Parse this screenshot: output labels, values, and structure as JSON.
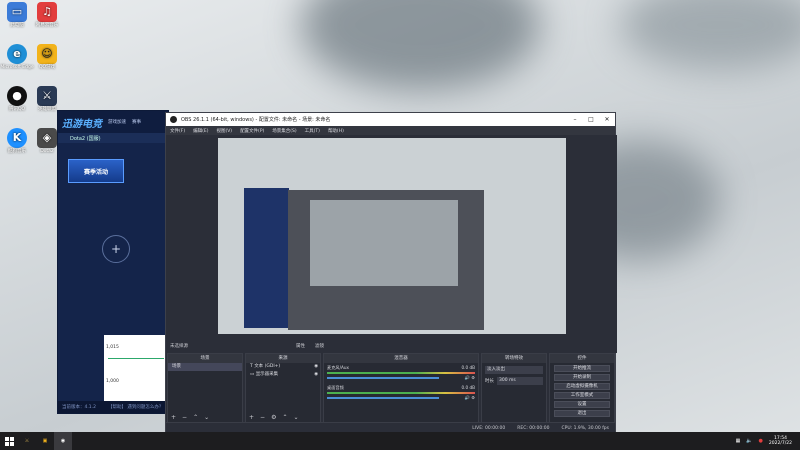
{
  "desktop": {
    "icons": [
      {
        "label": "此电脑",
        "icon": "computer-icon",
        "color": "#3b7bd8"
      },
      {
        "label": "网易云音乐",
        "icon": "music-icon",
        "color": "#e23d3d"
      },
      {
        "label": "Microsoft Edge",
        "icon": "edge-icon",
        "color": "#1f8fd6"
      },
      {
        "label": "QQ游戏",
        "icon": "game-icon",
        "color": "#f2b31b"
      },
      {
        "label": "腾讯QQ",
        "icon": "qq-icon",
        "color": "#111111"
      },
      {
        "label": "英雄联盟",
        "icon": "lol-icon",
        "color": "#2a3a55"
      },
      {
        "label": "酷狗音乐",
        "icon": "kugou-icon",
        "color": "#1e90ff"
      },
      {
        "label": "Dota2",
        "icon": "dota-icon",
        "color": "#4a4a4a"
      }
    ]
  },
  "booster": {
    "logo": "迅游电竞",
    "tabs": [
      "游戏加速",
      "赛事"
    ],
    "game": "Dota2 (国服)",
    "card": "赛季活动",
    "plus": "+",
    "graph_values": [
      "1,015",
      "1,000"
    ],
    "footer_version": "当前版本：4.1.2",
    "footer_link": "【帮助】 遇到问题怎么办？"
  },
  "obs": {
    "title": "OBS 26.1.1 (64-bit, windows) - 配置文件: 未命名 - 场景: 未命名",
    "menus": [
      "文件(F)",
      "编辑(E)",
      "视图(V)",
      "配置文件(P)",
      "场景集合(S)",
      "工具(T)",
      "帮助(H)"
    ],
    "no_source": "未选择源",
    "src_props": "属性",
    "src_filters": "滤镜",
    "panels": {
      "scenes": {
        "title": "场景",
        "items": [
          "场景"
        ]
      },
      "sources": {
        "title": "来源",
        "items": [
          "文本 (GDI+)",
          "显示器采集"
        ]
      },
      "mixer": {
        "title": "混音器",
        "rows": [
          {
            "name": "麦克风/Aux",
            "db": "0.0 dB"
          },
          {
            "name": "桌面音频",
            "db": "0.0 dB"
          }
        ]
      },
      "transitions": {
        "title": "转场特效",
        "type": "淡入淡出",
        "duration_label": "时长",
        "duration": "300 ms"
      },
      "controls": {
        "title": "控件",
        "buttons": [
          "开始推流",
          "开始录制",
          "启动虚拟摄像机",
          "工作室模式",
          "设置",
          "退出"
        ]
      }
    },
    "status": {
      "live": "LIVE: 00:00:00",
      "rec": "REC: 00:00:00",
      "cpu": "CPU: 1.9%, 30.00 fps"
    }
  },
  "taskbar": {
    "time": "17:54",
    "date": "2022/7/22"
  }
}
